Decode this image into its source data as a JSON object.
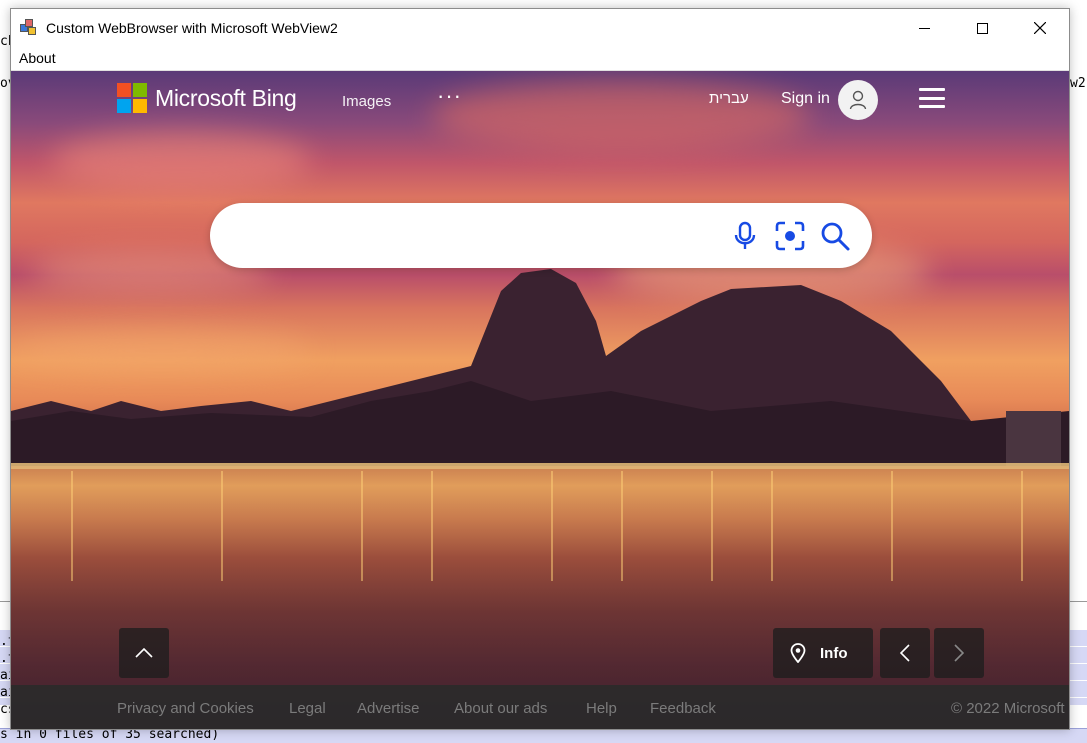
{
  "background": {
    "frag_top_left": "ch",
    "frag_mid_left": "ov",
    "frag_right": "w2",
    "frag_lines": [
      ".t",
      ".t",
      "ai",
      "ai",
      "cs"
    ],
    "frag_bottom": "s in 0 files of 35 searched)"
  },
  "window": {
    "title": "Custom WebBrowser with Microsoft WebView2",
    "menu": [
      "About"
    ]
  },
  "bing": {
    "logo_text": "Microsoft Bing",
    "logo_colors": [
      "#f25022",
      "#7fba00",
      "#00a4ef",
      "#ffb900"
    ],
    "nav_images": "Images",
    "nav_more": "···",
    "language": "עברית",
    "sign_in": "Sign in",
    "search_placeholder": "",
    "info_label": "Info",
    "accent_color": "#174ae4"
  },
  "footer": {
    "links": [
      "Privacy and Cookies",
      "Legal",
      "Advertise",
      "About our ads",
      "Help",
      "Feedback"
    ],
    "copyright": "© 2022 Microsoft"
  }
}
